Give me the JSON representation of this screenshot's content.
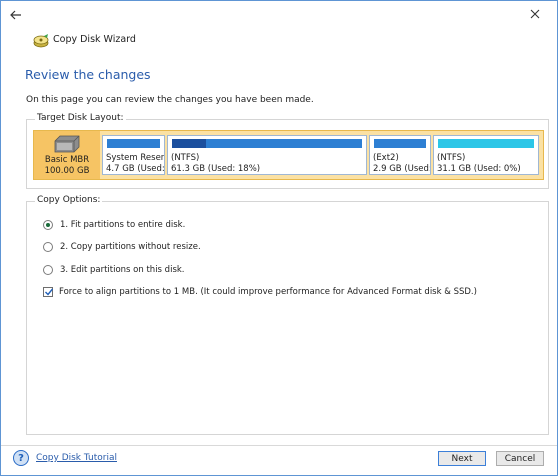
{
  "window": {
    "title": "Copy Disk Wizard"
  },
  "page": {
    "heading": "Review the changes",
    "description": "On this page you can review the changes you have been made."
  },
  "target_disk_layout": {
    "label": "Target Disk Layout:",
    "disk": {
      "name": "Basic MBR",
      "size": "100.00 GB"
    },
    "partitions": [
      {
        "name": "System Reserv",
        "info": "4.7 GB (Used:",
        "used_fraction": 0.0,
        "color": "#2d7fd3"
      },
      {
        "name": "(NTFS)",
        "info": "61.3 GB (Used: 18%)",
        "used_fraction": 0.18,
        "color": "#2d7fd3"
      },
      {
        "name": "(Ext2)",
        "info": "2.9 GB (Used:",
        "used_fraction": 0.0,
        "color": "#2d7fd3"
      },
      {
        "name": "(NTFS)",
        "info": "31.1 GB (Used: 0%)",
        "used_fraction": 0.0,
        "color": "#2dc6e7"
      }
    ]
  },
  "copy_options": {
    "label": "Copy Options:",
    "options": [
      {
        "label": "1. Fit partitions to entire disk.",
        "selected": true
      },
      {
        "label": "2. Copy partitions without resize.",
        "selected": false
      },
      {
        "label": "3. Edit partitions on this disk.",
        "selected": false
      }
    ],
    "align_checkbox": {
      "label": "Force to align partitions to 1 MB.  (It could improve performance for Advanced Format disk & SSD.)",
      "checked": true
    }
  },
  "footer": {
    "help_link": "Copy Disk Tutorial",
    "next_label": "Next",
    "cancel_label": "Cancel"
  },
  "colors": {
    "accent": "#2a5cab",
    "disk_highlight": "#f6c464",
    "partition_bar": "#2d7fd3",
    "partition_bar_alt": "#2dc6e7"
  },
  "icons": {
    "back": "back-arrow-icon",
    "app": "copy-disk-icon",
    "close": "close-icon",
    "disk": "hard-disk-icon",
    "help": "help-icon"
  }
}
